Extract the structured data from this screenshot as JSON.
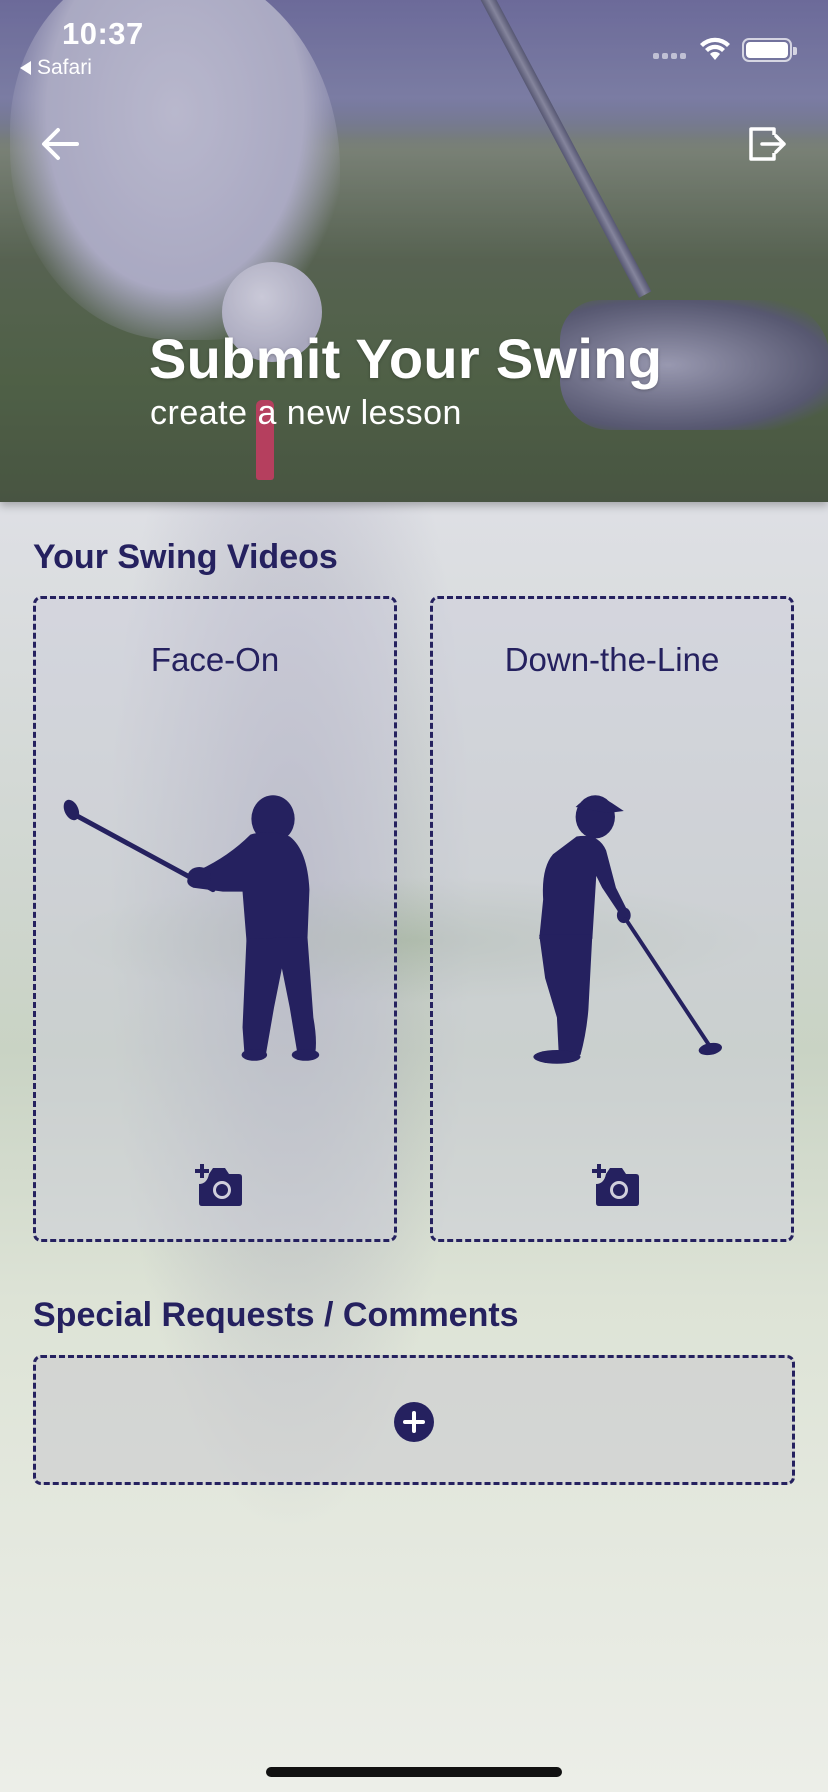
{
  "status_bar": {
    "time": "10:37",
    "back_app": "Safari",
    "icons": [
      "cellular-signal-icon",
      "wifi-icon",
      "battery-icon"
    ]
  },
  "nav": {
    "back_icon": "arrow-left-icon",
    "exit_icon": "exit-icon"
  },
  "hero": {
    "title": "Submit Your Swing",
    "subtitle": "create a new lesson"
  },
  "videos": {
    "heading": "Your Swing Videos",
    "cards": [
      {
        "label": "Face-On",
        "icon": "golfer-face-on-icon",
        "action_icon": "add-camera-icon"
      },
      {
        "label": "Down-the-Line",
        "icon": "golfer-down-the-line-icon",
        "action_icon": "add-camera-icon"
      }
    ]
  },
  "comments": {
    "heading": "Special Requests / Comments",
    "action_icon": "plus-circle-icon"
  },
  "colors": {
    "primary": "#25215f",
    "hero_text": "#ffffff"
  }
}
